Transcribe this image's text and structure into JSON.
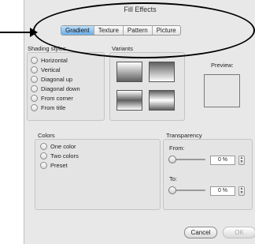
{
  "dialog": {
    "title": "Fill Effects"
  },
  "tabs": [
    {
      "label": "Gradient",
      "active": true
    },
    {
      "label": "Texture",
      "active": false
    },
    {
      "label": "Pattern",
      "active": false
    },
    {
      "label": "Picture",
      "active": false
    }
  ],
  "shading_styles": {
    "label": "Shading styles",
    "options": [
      "Horizontal",
      "Vertical",
      "Diagonal up",
      "Diagonal down",
      "From corner",
      "From title"
    ]
  },
  "variants": {
    "label": "Variants"
  },
  "preview": {
    "label": "Preview:"
  },
  "colors": {
    "label": "Colors",
    "options": [
      "One color",
      "Two colors",
      "Preset"
    ]
  },
  "transparency": {
    "label": "Transparency",
    "from_label": "From:",
    "from_value": "0 %",
    "to_label": "To:",
    "to_value": "0 %"
  },
  "buttons": {
    "cancel": "Cancel",
    "ok": "OK"
  },
  "icons": {
    "stepper": "stepper-icon",
    "slider": "slider-knob-icon"
  },
  "annotation": {
    "color": "#000000"
  }
}
